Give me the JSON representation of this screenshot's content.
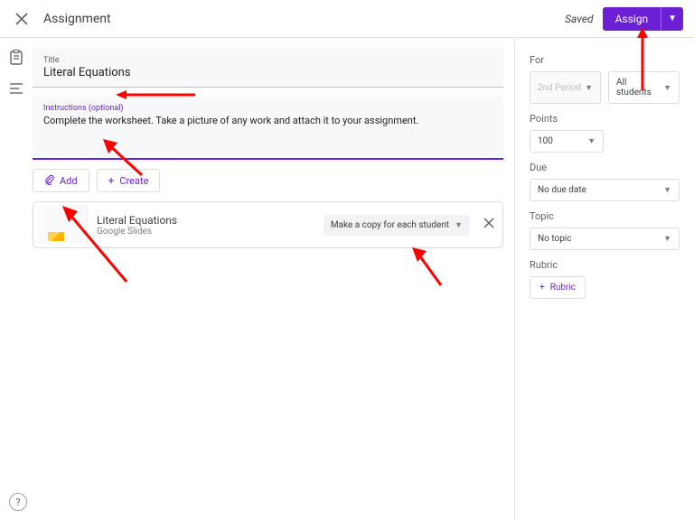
{
  "topbar": {
    "title": "Assignment",
    "saved_label": "Saved",
    "assign_label": "Assign"
  },
  "title_field": {
    "label": "Title",
    "value": "Literal Equations"
  },
  "instructions": {
    "label": "Instructions (optional)",
    "text": "Complete the worksheet. Take a picture of any work and attach it to your assignment."
  },
  "buttons": {
    "add": "Add",
    "create": "Create"
  },
  "attachment": {
    "title": "Literal Equations",
    "subtitle": "Google Slides",
    "option": "Make a copy for each student"
  },
  "sidebar": {
    "for_label": "For",
    "class_value": "2nd Period",
    "students_value": "All students",
    "points_label": "Points",
    "points_value": "100",
    "due_label": "Due",
    "due_value": "No due date",
    "topic_label": "Topic",
    "topic_value": "No topic",
    "rubric_label": "Rubric",
    "rubric_button": "Rubric"
  }
}
